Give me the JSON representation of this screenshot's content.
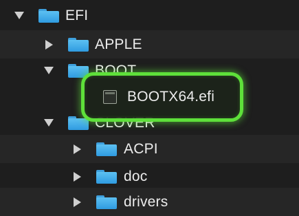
{
  "tree": {
    "items": [
      {
        "label": "EFI",
        "expanded": true,
        "icon": "folder-icon"
      },
      {
        "label": "APPLE",
        "expanded": false,
        "icon": "folder-icon"
      },
      {
        "label": "BOOT",
        "expanded": true,
        "icon": "folder-icon"
      },
      {
        "label": "BOOTX64.efi",
        "icon": "file-icon"
      },
      {
        "label": "CLOVER",
        "expanded": true,
        "icon": "folder-icon"
      },
      {
        "label": "ACPI",
        "expanded": false,
        "icon": "folder-icon"
      },
      {
        "label": "doc",
        "expanded": false,
        "icon": "folder-icon"
      },
      {
        "label": "drivers",
        "expanded": false,
        "icon": "folder-icon"
      }
    ]
  },
  "colors": {
    "background": "#1e1e1e",
    "folder": "#3ea0dd",
    "highlight": "#5ee03a",
    "text": "#ececec"
  }
}
